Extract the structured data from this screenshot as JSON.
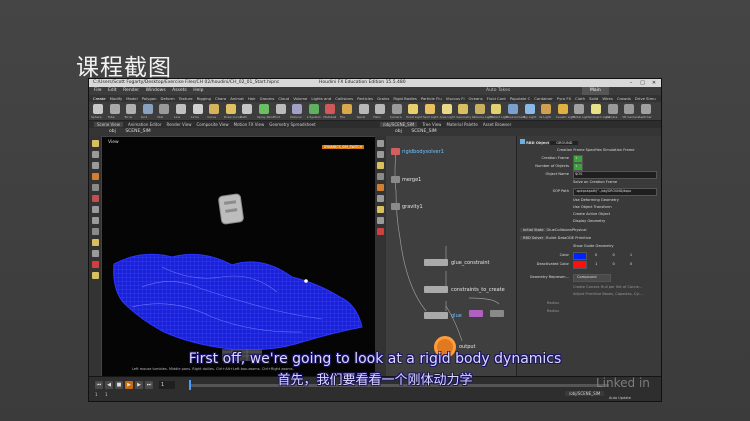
{
  "slide": {
    "title": "课程截图"
  },
  "window": {
    "path": "C:/Users/Scott Fogarty/Desktop/Exercise Files/CH 02/houdini/CH_02_01_Start.hipnc",
    "title": "Houdini FX Education Edition 15.5.480",
    "controls": [
      "–",
      "□",
      "✕"
    ]
  },
  "menu": {
    "items": [
      "File",
      "Edit",
      "Render",
      "Windows",
      "Assets",
      "Help"
    ],
    "auto_takes": "Auto Takes",
    "desktop_label": "Main"
  },
  "shelf": {
    "tabs": [
      "Create",
      "Modify",
      "Model",
      "Polygon",
      "Deform",
      "Texture",
      "Rigging",
      "Chara",
      "Animat",
      "Hair",
      "Grooms",
      "Cloud",
      "Volume",
      "Lights and",
      "Collisions",
      "Particles",
      "Grains",
      "Rigid Bodies",
      "Particle Flu",
      "Viscous Fl",
      "Oceans",
      "Fluid Cont",
      "Populate C",
      "Container",
      "Pyro FX",
      "Cloth",
      "Solid",
      "Wires",
      "Crowds",
      "Drive Simu"
    ],
    "tools": [
      {
        "label": "Sphere",
        "color": "#c8c8c8"
      },
      {
        "label": "Tube",
        "color": "#a8a8a8"
      },
      {
        "label": "Torus",
        "color": "#b0b0b0"
      },
      {
        "label": "Grid",
        "color": "#8aa0c0"
      },
      {
        "label": "Null",
        "color": "#9a9a9a"
      },
      {
        "label": "Line",
        "color": "#c0c0c0"
      },
      {
        "label": "Circle",
        "color": "#d0d0d0"
      },
      {
        "label": "Curve",
        "color": "#d6b35a"
      },
      {
        "label": "Draw Curve",
        "color": "#e0c060"
      },
      {
        "label": "Path",
        "color": "#c6c6c6"
      },
      {
        "label": "Spray Paint",
        "color": "#6ac060"
      },
      {
        "label": "Font",
        "color": "#bbbbbb"
      },
      {
        "label": "Platonic",
        "color": "#a0a0c8"
      },
      {
        "label": "L-System",
        "color": "#5fb060"
      },
      {
        "label": "Metaball",
        "color": "#d05858"
      },
      {
        "label": "File",
        "color": "#d8a84a"
      },
      {
        "label": "Spiral",
        "color": "#b8b8b8"
      },
      {
        "label": "Helix",
        "color": "#b8b8b8"
      },
      {
        "label": "Camera",
        "color": "#9a9a9a"
      },
      {
        "label": "Point Light",
        "color": "#e8d070"
      },
      {
        "label": "Spot Light",
        "color": "#e8c060"
      },
      {
        "label": "Area Light",
        "color": "#e8d888"
      },
      {
        "label": "Geometry Li",
        "color": "#d8c060"
      },
      {
        "label": "Volume Light",
        "color": "#c8b060"
      },
      {
        "label": "Distant Light",
        "color": "#e0d070"
      },
      {
        "label": "Environment",
        "color": "#7aa0d0"
      },
      {
        "label": "Sky Light",
        "color": "#8ab8e8"
      },
      {
        "label": "GI Light",
        "color": "#d0a050"
      },
      {
        "label": "Caustic Light",
        "color": "#e0b040"
      },
      {
        "label": "Portal Light",
        "color": "#a0a0a0"
      },
      {
        "label": "Ambient Light",
        "color": "#e8e088"
      },
      {
        "label": "Camera",
        "color": "#9a9a9a"
      },
      {
        "label": "VR Camera",
        "color": "#9a9a9a"
      },
      {
        "label": "Switcher",
        "color": "#a0a0a0"
      }
    ]
  },
  "left_pane": {
    "tabs": [
      "Scene View",
      "Animation Editor",
      "Render View",
      "Composite View",
      "Motion FX View",
      "Geometry Spreadsheet"
    ],
    "path": [
      "obj",
      "SCENE_SIM"
    ],
    "viewport_label": "View",
    "badge": "DYNAMICS_SIM_SWITCH",
    "status": "Left mouse tumbles. Middle pans. Right dollies. Ctrl+Alt+Left box-zooms. Ctrl+Right zooms."
  },
  "right_pane": {
    "tabs": [
      "/obj/SCENE_SIM",
      "Tree View",
      "Material Palette",
      "Asset Browser"
    ],
    "path": [
      "obj",
      "SCENE_SIM"
    ]
  },
  "nodes": [
    {
      "label": "rigidbodysolver1",
      "color": "#d06060",
      "label_color": "#6fc3ff"
    },
    {
      "label": "merge1",
      "color": "#8a8a8a",
      "label_color": "#e6e6e6"
    },
    {
      "label": "gravity1",
      "color": "#8a8a8a",
      "label_color": "#e6e6e6"
    },
    {
      "label": "glue_constraint",
      "color": "#9a9a9a",
      "label_color": "#e6e6e6"
    },
    {
      "label": "constraints_to_create",
      "color": "#9a9a9a",
      "label_color": "#e6e6e6"
    },
    {
      "label": "glue",
      "color": "#9a9a9a",
      "label_color": "#6fc3ff"
    },
    {
      "label": "output",
      "color": "#e07a20",
      "label_color": "#e6e6e6"
    }
  ],
  "params": {
    "header_type": "RBD Object",
    "header_name": "GROUND",
    "top_tab": "Creation Frame Specifies Simulation Frame",
    "rows": [
      {
        "label": "Creation Frame",
        "value": "1"
      },
      {
        "label": "Number of Objects",
        "value": "1"
      },
      {
        "label": "Object Name",
        "value": "$OS"
      },
      {
        "label": "",
        "value": "Solve on Creation Frame"
      },
      {
        "label": "SOP Path",
        "value": "`opinputpath(\"../obj/GROUND/dopo"
      },
      {
        "label": "",
        "value": "Use Deforming Geometry"
      },
      {
        "label": "",
        "value": "Use Object Transform"
      },
      {
        "label": "",
        "value": "Create Active Object"
      },
      {
        "label": "",
        "value": "Display Geometry"
      }
    ],
    "tabs1": [
      "Initial State",
      "Glue",
      "Collisions",
      "Physical"
    ],
    "tabs2": [
      "RBD Solver",
      "Bullet Data",
      "ODE Primitive"
    ],
    "guide": "Show Guide Geometry",
    "color_label": "Color",
    "color_value": [
      "0",
      "0",
      "1"
    ],
    "deact_label": "Deactivated Color",
    "deact_value": [
      "1",
      "0",
      "0"
    ],
    "geo_rep_label": "Geometry Represen...",
    "geo_rep_value": "Compound",
    "extra": [
      "Create Convex Hull per Set of Conne...",
      "Adjust Primitive Boxes, Capsules, Cyl..."
    ],
    "bottom_labels": [
      "Radius",
      "Radius"
    ],
    "accent_box": "#3aa33a",
    "color_swatch": "#0022ff",
    "deact_swatch": "#ff1010"
  },
  "timeline": {
    "frame": "1",
    "start": "1",
    "end": "1",
    "path_label": "/obj/SCENE_SIM",
    "update": "Auto Update"
  },
  "subtitles": {
    "en": "First off, we're going to look at a rigid body dynamics",
    "zh": "首先，我们要看看一个刚体动力学"
  },
  "watermark": "Linked in"
}
